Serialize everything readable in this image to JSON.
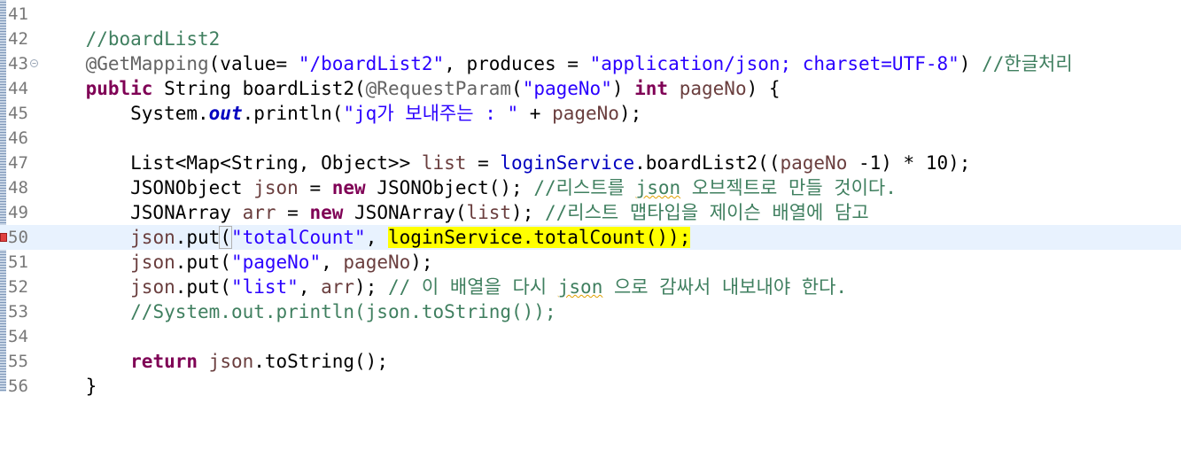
{
  "editor": {
    "lines": [
      {
        "number": "41",
        "text": ""
      },
      {
        "number": "42",
        "text": "    //boardList2"
      },
      {
        "number": "43",
        "text": "    @GetMapping(value= \"/boardList2\", produces = \"application/json; charset=UTF-8\") //한글처리"
      },
      {
        "number": "44",
        "text": "    public String boardList2(@RequestParam(\"pageNo\") int pageNo) {"
      },
      {
        "number": "45",
        "text": "        System.out.println(\"jq가 보내주는 : \" + pageNo);"
      },
      {
        "number": "46",
        "text": ""
      },
      {
        "number": "47",
        "text": "        List<Map<String, Object>> list = loginService.boardList2((pageNo -1) * 10);"
      },
      {
        "number": "48",
        "text": "        JSONObject json = new JSONObject(); //리스트를 json 오브젝트로 만들 것이다."
      },
      {
        "number": "49",
        "text": "        JSONArray arr = new JSONArray(list); //리스트 맵타입을 제이슨 배열에 담고"
      },
      {
        "number": "50",
        "text": "        json.put(\"totalCount\", loginService.totalCount());"
      },
      {
        "number": "51",
        "text": "        json.put(\"pageNo\", pageNo);"
      },
      {
        "number": "52",
        "text": "        json.put(\"list\", arr); // 이 배열을 다시 json 으로 감싸서 내보내야 한다."
      },
      {
        "number": "53",
        "text": "        //System.out.println(json.toString());"
      },
      {
        "number": "54",
        "text": ""
      },
      {
        "number": "55",
        "text": "        return json.toString();"
      },
      {
        "number": "56",
        "text": "    }"
      }
    ],
    "current_line": "50",
    "fold_line": "43",
    "error_marker_line": "50",
    "highlighted_text": "loginService.totalCount());",
    "colors": {
      "keyword": "#7f0055",
      "comment": "#3f7f5f",
      "string": "#2a00ff",
      "annotation": "#646464",
      "static_field": "#0000c0",
      "local_variable": "#6a3e3e",
      "current_line_bg": "#e8f2fe",
      "highlight": "#ffff00"
    }
  }
}
